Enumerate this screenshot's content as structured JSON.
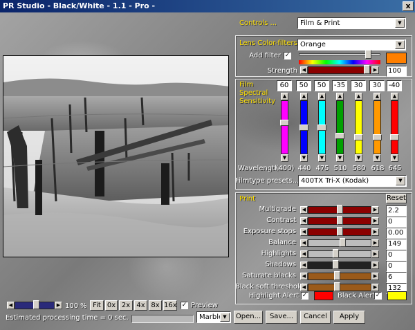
{
  "window": {
    "title": "PR Studio - Black/White - 1.1 - Pro -",
    "close": "x"
  },
  "controls": {
    "label": "Controls ...",
    "value": "Film & Print"
  },
  "lens": {
    "label": "Lens Color-filters",
    "filter_value": "Orange",
    "add_filter_label": "Add filter",
    "add_filter_checked": "✓",
    "swatch_color": "#ff7f00",
    "strength_label": "Strength",
    "strength_value": "100",
    "hue_level": 0.88,
    "strength_level": 0.98
  },
  "film": {
    "label_line1": "Film",
    "label_line2": "Spectral",
    "label_line3": "Sensitivity",
    "channels": [
      {
        "value": "60",
        "wavelength": "(400)",
        "color": "#ff00ff",
        "level": 0.6
      },
      {
        "value": "50",
        "wavelength": "440",
        "color": "#0000ff",
        "level": 0.5
      },
      {
        "value": "50",
        "wavelength": "475",
        "color": "#00ffff",
        "level": 0.5
      },
      {
        "value": "-35",
        "wavelength": "510",
        "color": "#00a000",
        "level": 0.325
      },
      {
        "value": "30",
        "wavelength": "580",
        "color": "#ffff00",
        "level": 0.3
      },
      {
        "value": "30",
        "wavelength": "618",
        "color": "#ff9900",
        "level": 0.3
      },
      {
        "value": "-40",
        "wavelength": "645",
        "color": "#ff0000",
        "level": 0.3
      }
    ],
    "wavelength_label": "Wavelength...",
    "preset_label": "Filmtype presets...",
    "preset_value": "400TX Tri-X (Kodak)"
  },
  "print": {
    "label": "Print",
    "reset": "Reset",
    "rows": [
      {
        "label": "Multigrade",
        "value": "2.2",
        "color": "#8b0000",
        "level": 0.5
      },
      {
        "label": "Contrast",
        "value": "0",
        "color": "#8b0000",
        "level": 0.5
      },
      {
        "label": "Exposure stops",
        "value": "0.00",
        "color": "#8b0000",
        "level": 0.5
      },
      {
        "label": "Balance",
        "value": "149",
        "color": "#bdbdbd",
        "level": 0.55
      },
      {
        "label": "Highlights",
        "value": "0",
        "color": "#bdbdbd",
        "level": 0.43
      },
      {
        "label": "Shadows",
        "value": "0",
        "color": "#222222",
        "level": 0.43
      },
      {
        "label": "Saturate blacks",
        "value": "6",
        "color": "#9a5a1a",
        "level": 0.46
      },
      {
        "label": "Black soft threshold",
        "value": "132",
        "color": "#9a5a1a",
        "level": 0.46
      }
    ],
    "highlight_alert_label": "Highlight Alert",
    "highlight_alert_checked": "✓",
    "highlight_alert_color": "#ff0000",
    "black_alert_label": "Black Alert",
    "black_alert_checked": "✓",
    "black_alert_color": "#ffff00"
  },
  "bottom": {
    "zoom_value": "100",
    "zoom_unit": "%",
    "zoom_level": 0.55,
    "zoom_buttons": [
      "Fit",
      "0x",
      "2x",
      "4x",
      "8x",
      "16x"
    ],
    "preview_label": "Preview",
    "preview_checked": "✓",
    "processing_text": "Estimated processing time =  0 sec.",
    "theme_value": "Marble",
    "open": "Open...",
    "save": "Save...",
    "cancel": "Cancel",
    "apply": "Apply"
  }
}
